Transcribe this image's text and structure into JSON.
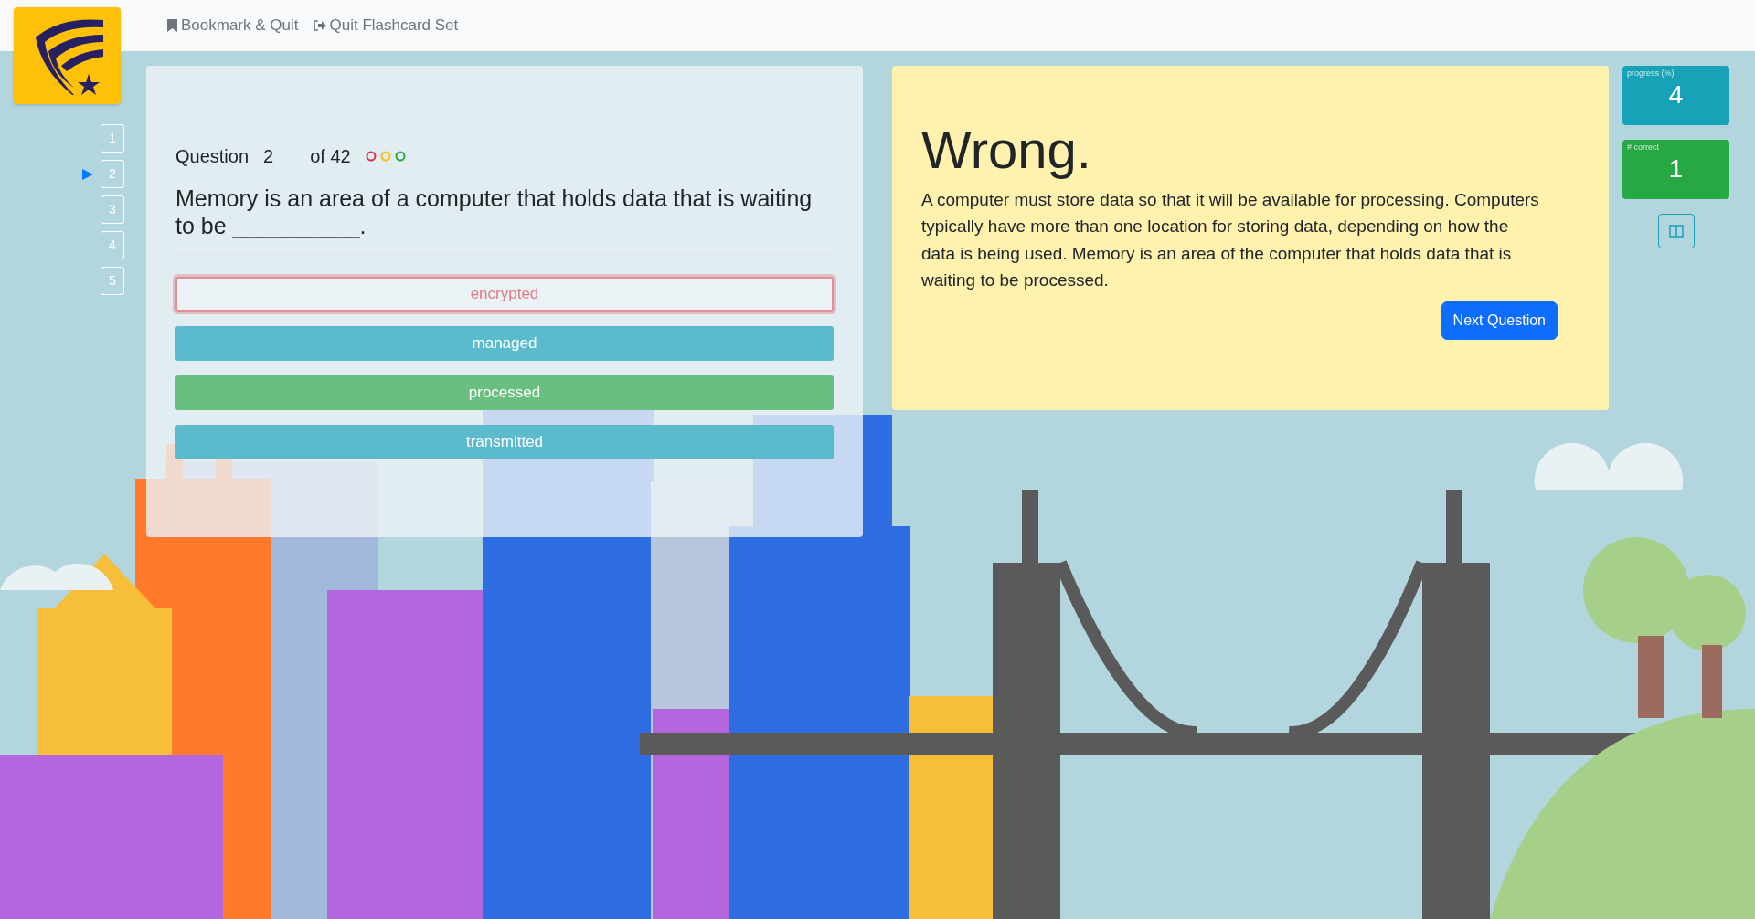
{
  "nav_links": [
    {
      "kind": "bookmark",
      "label": "Bookmark & Quit"
    },
    {
      "kind": "quit",
      "label": "Quit Flashcard Set"
    }
  ],
  "question_nav": [
    {
      "label": "1",
      "selected": false
    },
    {
      "label": "2",
      "selected": true
    },
    {
      "label": "3",
      "selected": false
    },
    {
      "label": "4",
      "selected": false
    },
    {
      "label": "5",
      "selected": false
    }
  ],
  "question": {
    "label": "Question",
    "number": "2",
    "total": "of 42",
    "status_dots": [
      {
        "color": "#dc3545"
      },
      {
        "color": "#ffc107"
      },
      {
        "color": "#28a745"
      }
    ],
    "text": "Memory is an area of a computer that holds data that is waiting to be __________."
  },
  "answers": [
    {
      "label": "encrypted",
      "kind": "wrong"
    },
    {
      "label": "managed",
      "kind": "plain"
    },
    {
      "label": "processed",
      "kind": "correct"
    },
    {
      "label": "transmitted",
      "kind": "plain"
    }
  ],
  "feedback": {
    "title": "Wrong.",
    "explanation": "A computer must store data so that it will be available for processing. Computers typically have more than one location for storing data, depending on how the data is being used. Memory is an area of the computer that holds data that is waiting to be processed.",
    "button": "Next Question"
  },
  "stats": [
    {
      "kind": "info",
      "label": "progress (%)",
      "value": "4"
    },
    {
      "kind": "success",
      "label": "# correct",
      "value": "1"
    }
  ]
}
